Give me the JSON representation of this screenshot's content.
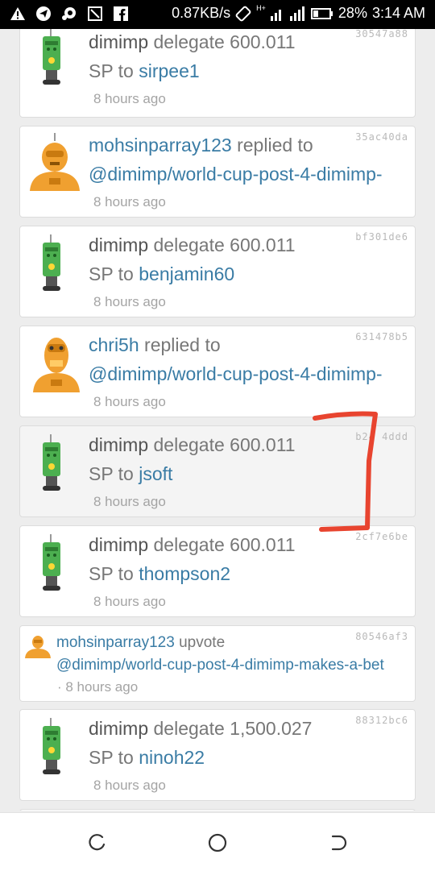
{
  "status_bar": {
    "speed": "0.87KB/s",
    "network": "H+",
    "battery": "28%",
    "time": "3:14 AM",
    "icons": [
      "warning-icon",
      "telegram-icon",
      "chat-icon",
      "screenshot-icon",
      "facebook-icon",
      "rotation-icon",
      "signal-icon",
      "battery-icon"
    ]
  },
  "feed": {
    "items": [
      {
        "avatar": "robot-green",
        "hash": "30547a88",
        "user": "dimimp",
        "action": " delegate 600.011",
        "pre": "SP to ",
        "target": "sirpee1",
        "time": "8 hours ago"
      },
      {
        "avatar": "robot-orange",
        "hash": "35ac40da",
        "user": "mohsinparray123",
        "action": " replied to",
        "pre": "",
        "target": "@dimimp/world-cup-post-4-dimimp-",
        "time": "8 hours ago"
      },
      {
        "avatar": "robot-green",
        "hash": "bf301de6",
        "user": "dimimp",
        "action": " delegate 600.011",
        "pre": "SP to ",
        "target": "benjamin60",
        "time": "8 hours ago"
      },
      {
        "avatar": "robot-orange-2",
        "hash": "631478b5",
        "user": "chri5h",
        "action": " replied to",
        "pre": "",
        "target": "@dimimp/world-cup-post-4-dimimp-",
        "time": "8 hours ago"
      },
      {
        "avatar": "robot-green",
        "hash": "b24 4ddd",
        "user": "dimimp",
        "action": " delegate 600.011",
        "pre": "SP to ",
        "target": "jsoft",
        "time": "8 hours ago"
      },
      {
        "avatar": "robot-green",
        "hash": "2cf7e6be",
        "user": "dimimp",
        "action": " delegate 600.011",
        "pre": "SP to ",
        "target": "thompson2",
        "time": "8 hours ago"
      },
      {
        "avatar": "robot-orange",
        "hash": "80546af3",
        "user": "mohsinparray123",
        "action": " upvote",
        "pre": "",
        "target": "@dimimp/world-cup-post-4-dimimp-makes-a-bet",
        "time": "· 8 hours ago"
      },
      {
        "avatar": "robot-green",
        "hash": "88312bc6",
        "user": "dimimp",
        "action": " delegate 1,500.027",
        "pre": "SP to ",
        "target": "ninoh22",
        "time": "8 hours ago"
      }
    ]
  },
  "nav_bar": {
    "buttons": [
      "recents-icon",
      "home-icon",
      "back-icon"
    ]
  },
  "colors": {
    "link": "#3a7ca5",
    "annotation": "#e8442f",
    "robot_green": "#4caf50",
    "robot_orange": "#f0a030"
  }
}
